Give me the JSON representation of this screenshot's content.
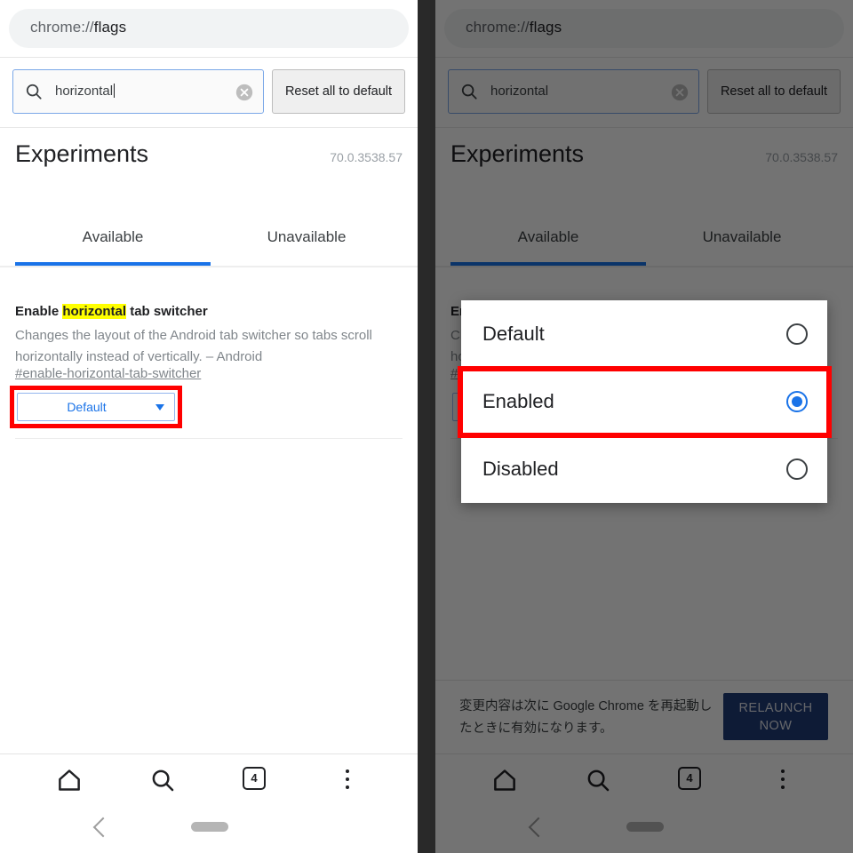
{
  "omnibox": {
    "scheme": "chrome://",
    "path": "flags"
  },
  "search": {
    "value": "horizontal",
    "icon": "search-icon",
    "clear_icon": "clear-circle-icon"
  },
  "reset_button": {
    "label": "Reset all to default"
  },
  "experiments": {
    "title": "Experiments",
    "version": "70.0.3538.57"
  },
  "tabs": [
    {
      "label": "Available",
      "active": true
    },
    {
      "label": "Unavailable",
      "active": false
    }
  ],
  "flag": {
    "title_before": "Enable ",
    "title_highlight": "horizontal",
    "title_after": " tab switcher",
    "description": "Changes the layout of the Android tab switcher so tabs scroll horizontally instead of vertically. – Android",
    "link": "#enable-horizontal-tab-switcher",
    "select_value": "Default"
  },
  "dialog": {
    "options": [
      {
        "label": "Default",
        "selected": false
      },
      {
        "label": "Enabled",
        "selected": true
      },
      {
        "label": "Disabled",
        "selected": false
      }
    ]
  },
  "relaunch": {
    "message": "変更内容は次に Google Chrome を再起動したときに有効になります。",
    "button_label": "RELAUNCH NOW"
  },
  "bottom_nav": {
    "home": "home-icon",
    "search": "search-icon",
    "tab_count": "4",
    "menu": "overflow-menu-icon"
  },
  "gesture_bar": {
    "back": "back-chevron-icon",
    "pill": "home-pill-handle"
  },
  "annotations": {
    "highlight_color": "#ff0000"
  }
}
